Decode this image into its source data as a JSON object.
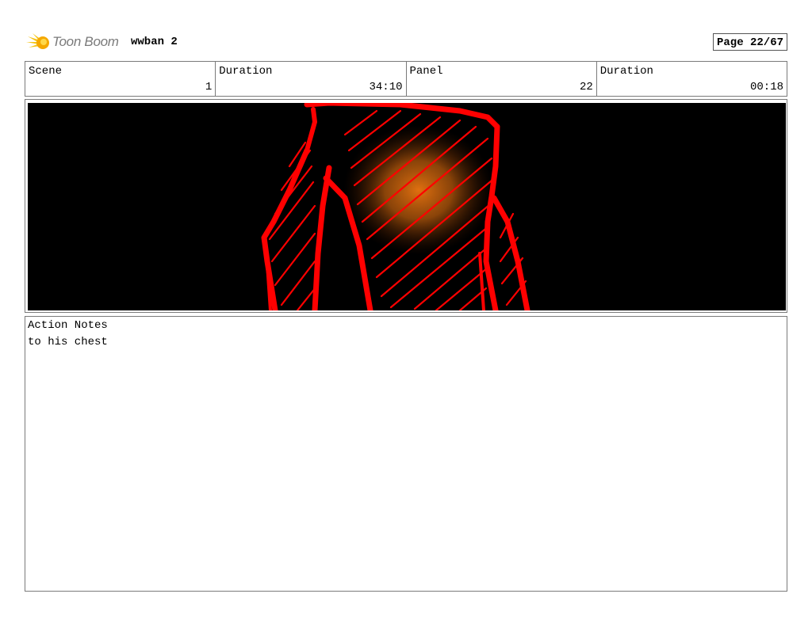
{
  "header": {
    "logo_text": "Toon Boom",
    "project_title": "wwban 2",
    "page_label": "Page 22/67"
  },
  "info": [
    {
      "label": "Scene",
      "value": "1"
    },
    {
      "label": "Duration",
      "value": "34:10"
    },
    {
      "label": "Panel",
      "value": "22"
    },
    {
      "label": "Duration",
      "value": "00:18"
    }
  ],
  "panel": {
    "background": "#000000",
    "stroke_color": "#ff0000",
    "glow_color": "#e07010"
  },
  "notes": {
    "label": "Action Notes",
    "text": "to his chest"
  }
}
